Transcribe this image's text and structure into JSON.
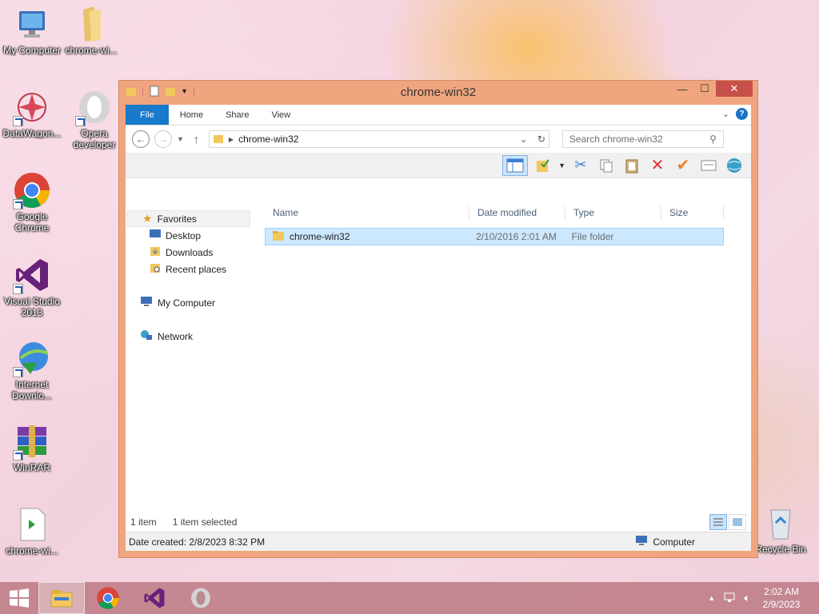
{
  "desktop": {
    "icons": [
      {
        "label": "My Computer"
      },
      {
        "label": "chrome-wi..."
      },
      {
        "label": "DataWagon..."
      },
      {
        "label": "Opera developer"
      },
      {
        "label": "Google Chrome"
      },
      {
        "label": "Visual Studio 2013"
      },
      {
        "label": "Internet Downlo..."
      },
      {
        "label": "WinRAR"
      },
      {
        "label": "chrome-wi..."
      },
      {
        "label": "Recycle Bin"
      }
    ]
  },
  "window": {
    "title": "chrome-win32",
    "tabs": [
      "File",
      "Home",
      "Share",
      "View"
    ],
    "help_label": "?",
    "address_path": "chrome-win32",
    "search_placeholder": "Search chrome-win32",
    "nav": {
      "favorites": "Favorites",
      "desktop": "Desktop",
      "downloads": "Downloads",
      "recent": "Recent places",
      "my_computer": "My Computer",
      "network": "Network"
    },
    "columns": {
      "name": "Name",
      "date": "Date modified",
      "type": "Type",
      "size": "Size"
    },
    "files": [
      {
        "name": "chrome-win32",
        "date": "2/10/2016 2:01 AM",
        "type": "File folder",
        "size": ""
      }
    ],
    "status": {
      "count": "1 item",
      "selected": "1 item selected"
    },
    "details": {
      "date_created": "Date created: 2/8/2023 8:32 PM",
      "location": "Computer"
    }
  },
  "taskbar": {
    "time": "2:02 AM",
    "date": "2/9/2023"
  },
  "colors": {
    "window_frame": "#f0a57e",
    "close_button": "#c7504a",
    "file_tab": "#1979ca",
    "selection": "#cce8ff"
  }
}
